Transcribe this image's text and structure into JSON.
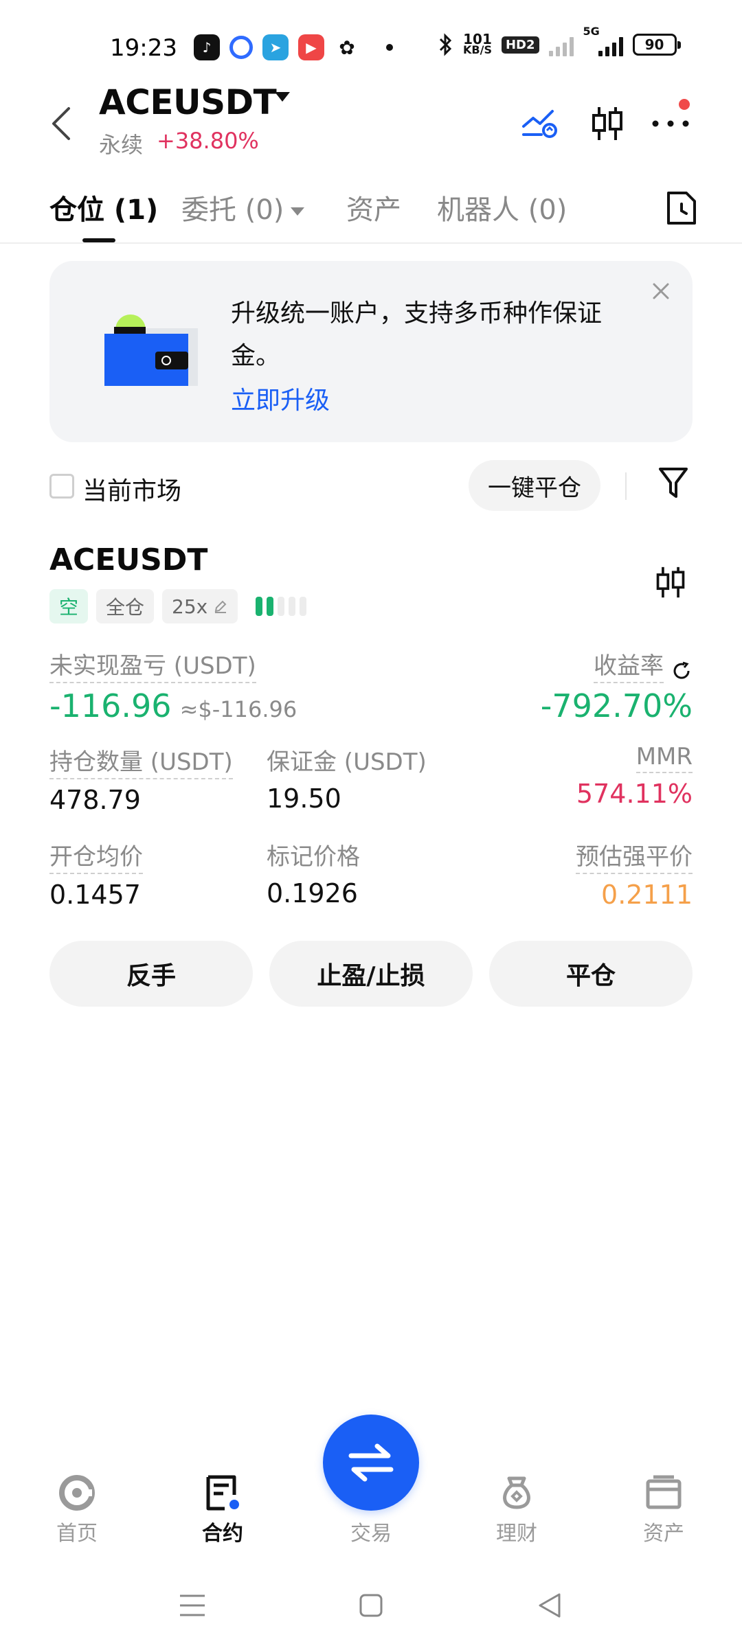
{
  "status_bar": {
    "time": "19:23",
    "net_speed_top": "101",
    "net_speed_bottom": "KB/S",
    "hd_label": "HD2",
    "network_label": "5G",
    "battery": "90"
  },
  "header": {
    "pair": "ACEUSDT",
    "type": "永续",
    "change": "+38.80%",
    "change_color": "#e0325f"
  },
  "tabs": [
    {
      "label": "仓位 (1)",
      "active": true
    },
    {
      "label": "委托 (0)",
      "active": false
    },
    {
      "label": "资产",
      "active": false
    },
    {
      "label": "机器人 (0)",
      "active": false
    }
  ],
  "banner": {
    "text": "升级统一账户，支持多币种作保证金。",
    "link": "立即升级"
  },
  "filter": {
    "checkbox_label": "当前市场",
    "close_all_label": "一键平仓"
  },
  "position": {
    "symbol": "ACEUSDT",
    "side_tag": "空",
    "margin_mode_tag": "全仓",
    "leverage_tag": "25x",
    "risk_level": 2,
    "risk_total": 5,
    "unrealized_pnl_label": "未实现盈亏 (USDT)",
    "unrealized_pnl_value": "-116.96",
    "unrealized_pnl_usd": "≈$-116.96",
    "roe_label": "收益率",
    "roe_value": "-792.70%",
    "size_label": "持仓数量 (USDT)",
    "size_value": "478.79",
    "margin_label": "保证金 (USDT)",
    "margin_value": "19.50",
    "mmr_label": "MMR",
    "mmr_value": "574.11%",
    "entry_label": "开仓均价",
    "entry_value": "0.1457",
    "mark_label": "标记价格",
    "mark_value": "0.1926",
    "liq_label": "预估强平价",
    "liq_value": "0.2111"
  },
  "actions": {
    "reverse": "反手",
    "tpsl": "止盈/止损",
    "close": "平仓"
  },
  "bottom_nav": [
    {
      "label": "首页",
      "icon": "home-icon"
    },
    {
      "label": "合约",
      "icon": "contract-icon",
      "active": true
    },
    {
      "label": "交易",
      "icon": "trade-icon"
    },
    {
      "label": "理财",
      "icon": "earn-icon"
    },
    {
      "label": "资产",
      "icon": "wallet-icon"
    }
  ],
  "colors": {
    "accent_blue": "#1a5ff5",
    "green": "#1ab26f",
    "red": "#e0325f",
    "orange": "#f5a04a"
  }
}
